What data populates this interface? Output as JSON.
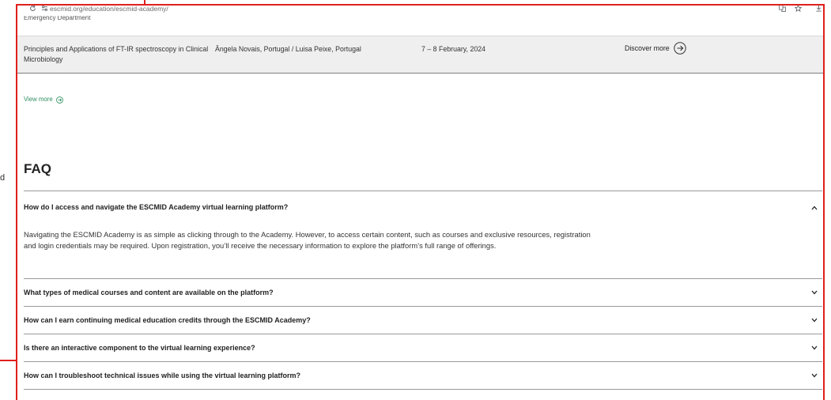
{
  "outside": {
    "left_text": "d"
  },
  "browser": {
    "url": "escmid.org/education/escmid-academy/",
    "icons": [
      "reload-icon",
      "site-info-icon",
      "translate-icon",
      "bookmark-star-icon",
      "download-icon"
    ]
  },
  "page": {
    "clipped_row_text": "Emergency Department",
    "course_row": {
      "title": "Principles and Applications of FT-IR spectroscopy in Clinical Microbiology",
      "authors": "Ângela Novais, Portugal / Luisa Peixe, Portugal",
      "dates": "7 – 8 February, 2024",
      "link_label": "Discover more",
      "link_icon": "circle-arrow-right-icon"
    },
    "view_more_label": "View more",
    "faq": {
      "heading": "FAQ",
      "items": [
        {
          "question": "How do I access and navigate the ESCMID Academy virtual learning platform?",
          "expanded": true,
          "answer": "Navigating the ESCMID Academy is as simple as clicking through to the Academy. However, to access certain content, such as courses and exclusive resources, registration and login credentials may be required. Upon registration, you’ll receive the necessary information to explore the platform’s full range of offerings."
        },
        {
          "question": "What types of medical courses and content are available on the platform?",
          "expanded": false
        },
        {
          "question": "How can I earn continuing medical education credits through the ESCMID Academy?",
          "expanded": false
        },
        {
          "question": "Is there an interactive component to the virtual learning experience?",
          "expanded": false
        },
        {
          "question": "How can I troubleshoot technical issues while using the virtual learning platform?",
          "expanded": false
        }
      ]
    }
  },
  "colors": {
    "annotation_red": "#e0201d",
    "link_green": "#2e8f61",
    "course_row_background": "#efefef",
    "divider": "#9a9a9a",
    "text": "#222222"
  }
}
